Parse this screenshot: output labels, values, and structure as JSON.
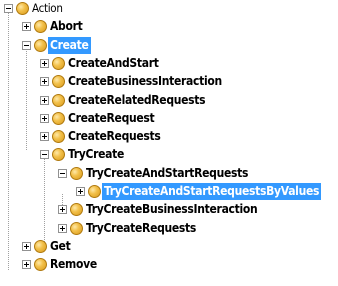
{
  "tree": {
    "nodes": [
      {
        "label": "Action",
        "depth": 0,
        "state": "expanded",
        "style": "root"
      },
      {
        "label": "Abort",
        "depth": 1,
        "state": "collapsed",
        "style": "normal"
      },
      {
        "label": "Create",
        "depth": 1,
        "state": "expanded",
        "style": "selected"
      },
      {
        "label": "CreateAndStart",
        "depth": 2,
        "state": "collapsed",
        "style": "normal"
      },
      {
        "label": "CreateBusinessInteraction",
        "depth": 2,
        "state": "collapsed",
        "style": "normal"
      },
      {
        "label": "CreateRelatedRequests",
        "depth": 2,
        "state": "collapsed",
        "style": "normal"
      },
      {
        "label": "CreateRequest",
        "depth": 2,
        "state": "collapsed",
        "style": "normal"
      },
      {
        "label": "CreateRequests",
        "depth": 2,
        "state": "collapsed",
        "style": "normal"
      },
      {
        "label": "TryCreate",
        "depth": 2,
        "state": "expanded",
        "style": "normal"
      },
      {
        "label": "TryCreateAndStartRequests",
        "depth": 3,
        "state": "expanded",
        "style": "normal"
      },
      {
        "label": "TryCreateAndStartRequestsByValues",
        "depth": 4,
        "state": "collapsed",
        "style": "highlight"
      },
      {
        "label": "TryCreateBusinessInteraction",
        "depth": 3,
        "state": "collapsed",
        "style": "normal"
      },
      {
        "label": "TryCreateRequests",
        "depth": 3,
        "state": "collapsed",
        "style": "normal"
      },
      {
        "label": "Get",
        "depth": 1,
        "state": "collapsed",
        "style": "normal"
      },
      {
        "label": "Remove",
        "depth": 1,
        "state": "collapsed",
        "style": "normal"
      }
    ]
  },
  "colors": {
    "selection": "#3399ff",
    "node_icon": "#f2c04a",
    "tree_lines": "#a0a0a0"
  },
  "icons": {
    "node": "folder-node-icon",
    "expand": "plus-box-icon",
    "collapse": "minus-box-icon"
  }
}
